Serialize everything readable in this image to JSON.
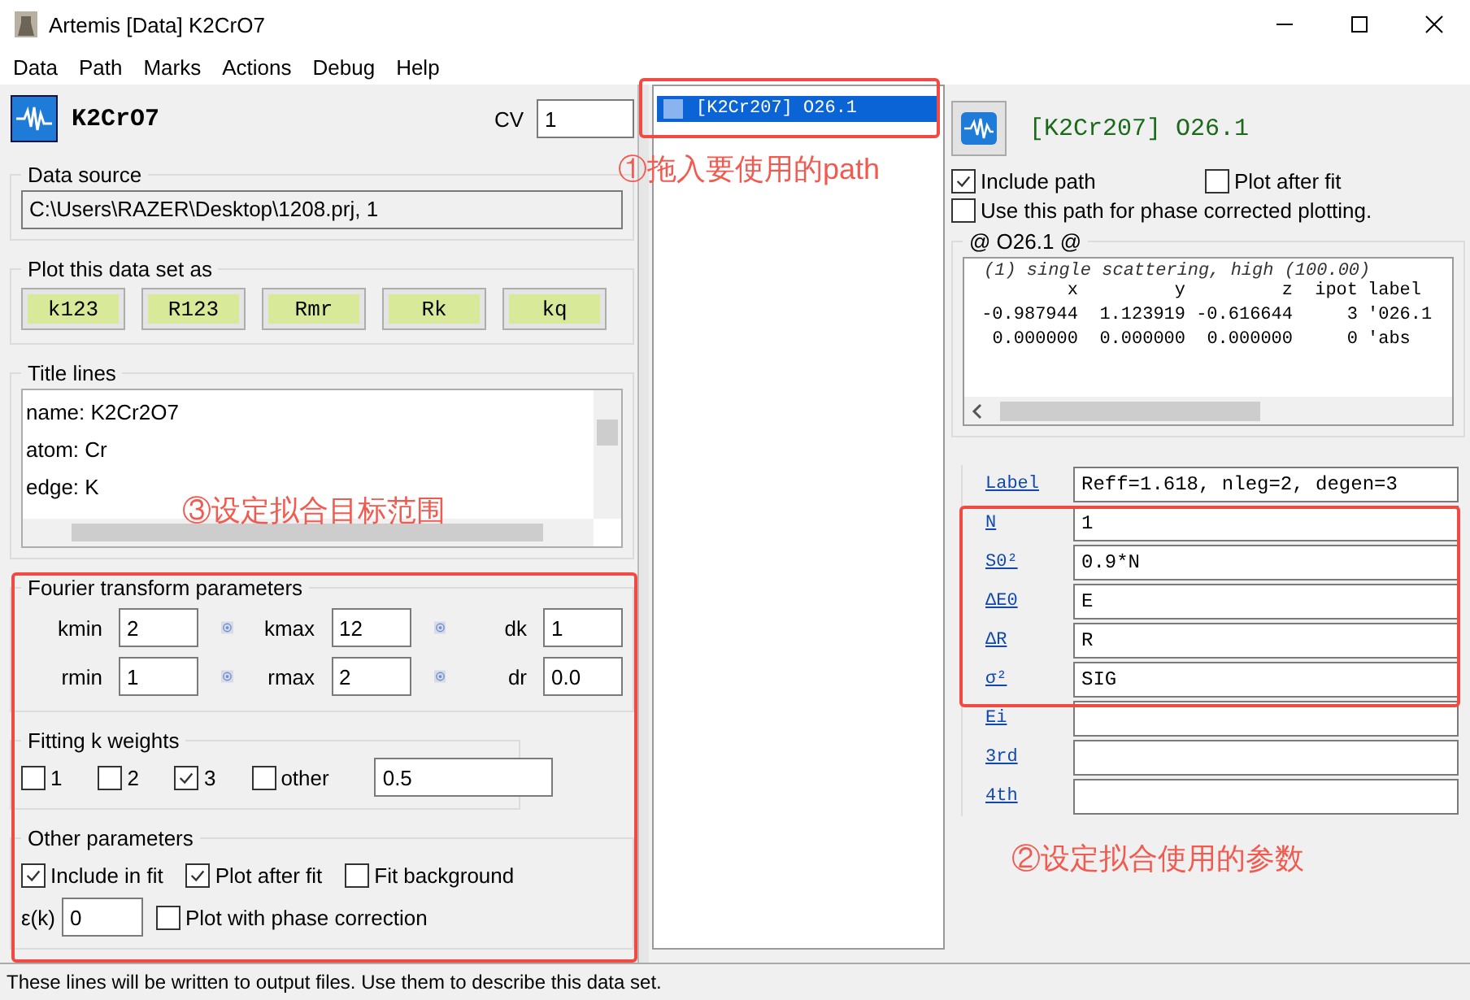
{
  "window": {
    "title": "Artemis [Data] K2CrO7"
  },
  "menu": [
    "Data",
    "Path",
    "Marks",
    "Actions",
    "Debug",
    "Help"
  ],
  "data_panel": {
    "name": "K2CrO7",
    "cv_label": "CV",
    "cv": "1",
    "data_source": {
      "legend": "Data source",
      "value": "C:\\Users\\RAZER\\Desktop\\1208.prj, 1"
    },
    "plot_as": {
      "legend": "Plot this data set as",
      "buttons": [
        "k123",
        "R123",
        "Rmr",
        "Rk",
        "kq"
      ]
    },
    "title_lines": {
      "legend": "Title lines",
      "lines": [
        "name: K2Cr2O7",
        "atom: Cr",
        "edge: K"
      ]
    },
    "fourier": {
      "legend": "Fourier transform parameters",
      "rows": [
        [
          {
            "label": "kmin",
            "value": "2",
            "picker": true
          },
          {
            "label": "kmax",
            "value": "12",
            "picker": true
          },
          {
            "label": "dk",
            "value": "1",
            "picker": false
          }
        ],
        [
          {
            "label": "rmin",
            "value": "1",
            "picker": true
          },
          {
            "label": "rmax",
            "value": "2",
            "picker": true
          },
          {
            "label": "dr",
            "value": "0.0",
            "picker": false
          }
        ]
      ]
    },
    "k_weights": {
      "legend": "Fitting k weights",
      "options": [
        {
          "label": "1",
          "checked": false
        },
        {
          "label": "2",
          "checked": false
        },
        {
          "label": "3",
          "checked": true
        },
        {
          "label": "other",
          "checked": false
        }
      ],
      "other_value": "0.5"
    },
    "other_params": {
      "legend": "Other parameters",
      "checks": [
        {
          "label": "Include in fit",
          "checked": true
        },
        {
          "label": "Plot after fit",
          "checked": true
        },
        {
          "label": "Fit background",
          "checked": false
        }
      ],
      "epsilon_label": "ε(k)",
      "epsilon": "0",
      "phase": {
        "label": "Plot with phase correction",
        "checked": false
      }
    }
  },
  "path_list": [
    {
      "label": "[K2Cr207] O26.1",
      "selected": true
    }
  ],
  "path_panel": {
    "title": "[K2Cr207] O26.1",
    "checks": [
      {
        "label": "Include path",
        "checked": true
      },
      {
        "label": "Plot after fit",
        "checked": false
      },
      {
        "label": "Use this path for phase corrected plotting.",
        "checked": false
      }
    ],
    "feff": {
      "legend": "@ O26.1  @",
      "header": "(1) single scattering, high (100.00)",
      "columns": [
        "x",
        "y",
        "z",
        "ipot",
        "label"
      ],
      "rows": [
        [
          "-0.987944",
          "1.123919",
          "-0.616644",
          "3",
          "'026.1"
        ],
        [
          "0.000000",
          "0.000000",
          "0.000000",
          "0",
          "'abs"
        ]
      ]
    },
    "params": [
      {
        "label": "Label",
        "value": "Reff=1.618, nleg=2, degen=3"
      },
      {
        "label": "N",
        "value": "1"
      },
      {
        "label": "S0²",
        "value": "0.9*N"
      },
      {
        "label": "ΔE0",
        "value": "E"
      },
      {
        "label": "ΔR",
        "value": "R"
      },
      {
        "label": "σ²",
        "value": "SIG"
      },
      {
        "label": "Ei"
      },
      {
        "label": "3rd"
      },
      {
        "label": "4th"
      }
    ]
  },
  "annotations": [
    "①拖入要使用的path",
    "③设定拟合目标范围",
    "②设定拟合使用的参数"
  ],
  "status_bar": "These lines will be written to output files.  Use them to describe this data set."
}
